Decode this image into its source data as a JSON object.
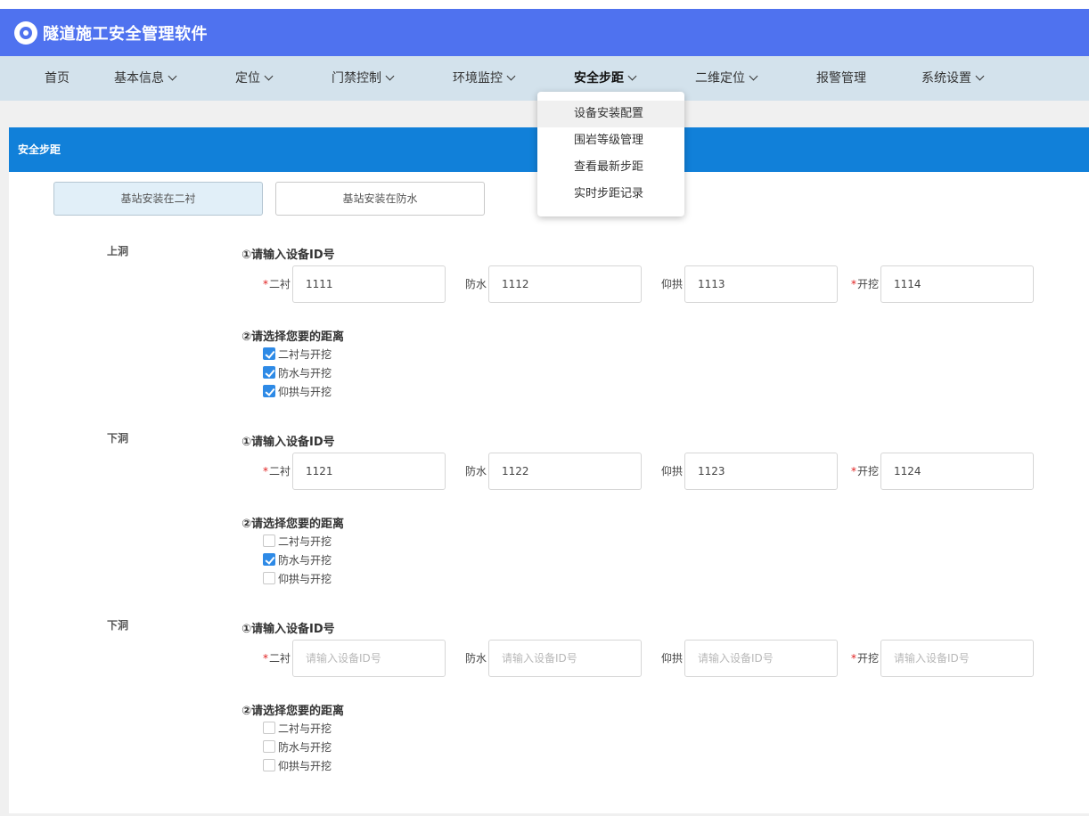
{
  "app": {
    "title": "隧道施工安全管理软件"
  },
  "nav": {
    "items": [
      {
        "label": "首页",
        "has_dropdown": false
      },
      {
        "label": "基本信息",
        "has_dropdown": true
      },
      {
        "label": "定位",
        "has_dropdown": true
      },
      {
        "label": "门禁控制",
        "has_dropdown": true
      },
      {
        "label": "环境监控",
        "has_dropdown": true
      },
      {
        "label": "安全步距",
        "has_dropdown": true,
        "active": true
      },
      {
        "label": "二维定位",
        "has_dropdown": true
      },
      {
        "label": "报警管理",
        "has_dropdown": false
      },
      {
        "label": "系统设置",
        "has_dropdown": true
      }
    ]
  },
  "dropdown": {
    "items": [
      "设备安装配置",
      "围岩等级管理",
      "查看最新步距",
      "实时步距记录"
    ]
  },
  "panel": {
    "title": "安全步距"
  },
  "toggles": [
    "基站安装在二衬",
    "基站安装在防水"
  ],
  "labels": {
    "step1": "①请输入设备ID号",
    "step2": "②请选择您要的距离",
    "req_mark": "*",
    "fields": [
      "二衬",
      "防水",
      "仰拱",
      "开挖"
    ],
    "checks": [
      "二衬与开挖",
      "防水与开挖",
      "仰拱与开挖"
    ]
  },
  "placeholder": "请输入设备ID号",
  "sections": [
    {
      "label": "上洞",
      "values": [
        "1111",
        "1112",
        "1113",
        "1114"
      ],
      "checked": [
        true,
        true,
        true
      ]
    },
    {
      "label": "下洞",
      "values": [
        "1121",
        "1122",
        "1123",
        "1124"
      ],
      "checked": [
        false,
        true,
        false
      ]
    },
    {
      "label": "下洞",
      "values": [
        "",
        "",
        "",
        ""
      ],
      "checked": [
        false,
        false,
        false
      ]
    }
  ],
  "colors": {
    "header": "#4f72ef",
    "nav": "#d3e2ec",
    "panel_header": "#1180d9",
    "checkbox": "#2e8ae6",
    "required": "#e02020"
  }
}
